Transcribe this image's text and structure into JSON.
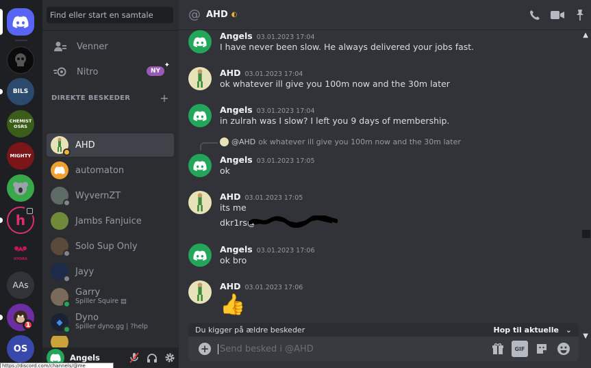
{
  "app": {
    "name": "Discord"
  },
  "servers": [
    {
      "name": "Direct Messages",
      "kind": "home"
    },
    {
      "name": "black circle avatar",
      "kind": "server"
    },
    {
      "name": "BILS",
      "kind": "server"
    },
    {
      "name": "CHEMIST OSRS",
      "kind": "server"
    },
    {
      "name": "MIGHTY",
      "kind": "server"
    },
    {
      "name": "koala",
      "kind": "server"
    },
    {
      "name": "h",
      "kind": "server"
    },
    {
      "name": "HYDRA",
      "kind": "server"
    },
    {
      "name": "AAs",
      "kind": "server",
      "label": "AAs"
    },
    {
      "name": "monkey",
      "kind": "server",
      "badge": "1"
    },
    {
      "name": "OS",
      "kind": "server"
    }
  ],
  "server_labels": {
    "bils": "BILS",
    "chemist": "CHEMIST OSRS",
    "mighty": "MIGHTY",
    "hydra": "HYDRA",
    "os": "OS"
  },
  "sidebar": {
    "search_placeholder": "Find eller start en samtale",
    "nav": [
      {
        "label": "Venner"
      },
      {
        "label": "Nitro",
        "badge": "NY"
      }
    ],
    "dm_header": "DIREKTE BESKEDER",
    "dms": [
      {
        "name": "AHD",
        "active": true,
        "status": "idle"
      },
      {
        "name": "automaton",
        "status": "none"
      },
      {
        "name": "WyvernZT",
        "status": "offline"
      },
      {
        "name": "Jambs Fanjuice",
        "status": "none"
      },
      {
        "name": "Solo Sup Only",
        "status": "offline"
      },
      {
        "name": "Jayy",
        "status": "offline"
      },
      {
        "name": "Garry",
        "sub": "Spiller Squire",
        "status": "online"
      },
      {
        "name": "Dyno",
        "sub": "Spiller dyno.gg | ?help",
        "status": "online"
      }
    ],
    "user": {
      "name": "Angels"
    }
  },
  "tooltip": "https://discord.com/channels/@me",
  "chat": {
    "title": "AHD",
    "messages": [
      {
        "author": "Angels",
        "time": "03.01.2023 17:04",
        "lines": [
          "I have never been slow. He always delivered your jobs fast."
        ]
      },
      {
        "author": "AHD",
        "time": "03.01.2023 17:04",
        "lines": [
          "ok whatever ill give you 100m now and the 30m later"
        ]
      },
      {
        "author": "Angels",
        "time": "03.01.2023 17:04",
        "lines": [
          "in zulrah was I slow? I left you 9 days of membership."
        ]
      },
      {
        "author": "Angels",
        "time": "03.01.2023 17:05",
        "lines": [
          "ok"
        ],
        "reply": {
          "who": "@AHD",
          "text": "ok whatever ill give you 100m now and the 30m later"
        }
      },
      {
        "author": "AHD",
        "time": "03.01.2023 17:05",
        "lines": [
          "its me",
          "dkr1rs@"
        ]
      },
      {
        "author": "Angels",
        "time": "03.01.2023 17:06",
        "lines": [
          "ok bro"
        ]
      },
      {
        "author": "AHD",
        "time": "03.01.2023 17:06",
        "lines": [
          "👍"
        ]
      }
    ],
    "older_notice": "Du kigger på ældre beskeder",
    "jump_label": "Hop til aktuelle",
    "composer_placeholder": "Send besked i @AHD",
    "gif_label": "GIF"
  },
  "colors": {
    "blurple": "#5865f2",
    "online": "#23a55a",
    "idle": "#f0b232",
    "offline": "#80848e",
    "mention_badge": "#f23f43",
    "nitro_badge": "#9b59b6"
  }
}
